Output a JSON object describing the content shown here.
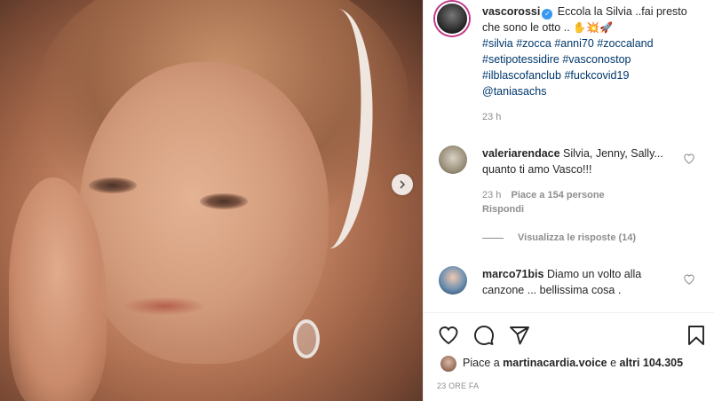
{
  "post": {
    "next_icon": "chevron-right-icon"
  },
  "caption": {
    "username": "vascorossi",
    "text": " Eccola la Silvia ..fai presto che sono le otto .. ",
    "emojis": "✋💥🚀",
    "hashtags": [
      "#silvia",
      "#zocca",
      "#anni70",
      "#zoccaland",
      "#setipotessidire",
      "#vasconostop",
      "#ilblascofanclub",
      "#fuckcovid19"
    ],
    "mention": "@taniasachs",
    "time": "23 h"
  },
  "comments": [
    {
      "username": "valeriarendace",
      "text": " Silvia, Jenny, Sally... quanto ti amo Vasco!!!",
      "time": "23 h",
      "likes": "Piace a 154 persone",
      "reply": "Rispondi",
      "view_replies": "Visualizza le risposte (14)"
    },
    {
      "username": "marco71bis",
      "text": " Diamo un volto alla canzone ... bellissima cosa ."
    }
  ],
  "actions": {
    "like_icon": "heart-icon",
    "comment_icon": "comment-icon",
    "share_icon": "share-icon",
    "save_icon": "bookmark-icon"
  },
  "likes_summary": {
    "prefix": "Piace a ",
    "user": "martinacardia.voice",
    "middle": " e ",
    "others": "altri 104.305"
  },
  "date": "23 ORE FA",
  "colors": {
    "link": "#00376b",
    "verified": "#3897f0",
    "muted": "#8e8e8e",
    "text": "#262626"
  }
}
